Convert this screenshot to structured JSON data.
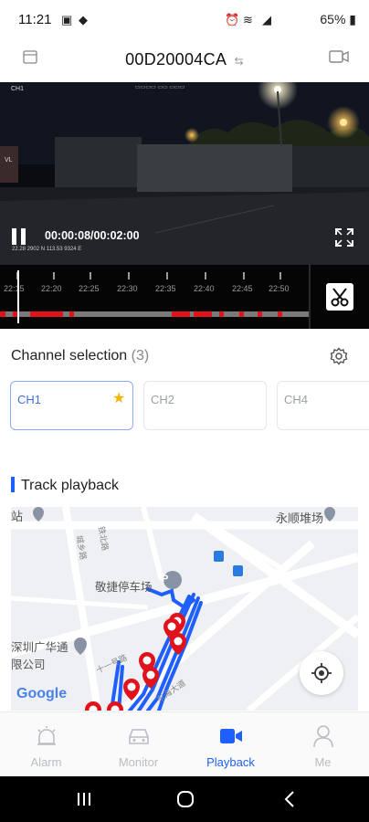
{
  "status_bar": {
    "time": "11:21",
    "battery": "65%"
  },
  "header": {
    "title": "00D20004CA"
  },
  "video": {
    "current_time": "00:00:08/00:02:00",
    "overlay_id": "CH1",
    "overlay_coords": "22.28 2902 N 113.53 9324 E",
    "overlay_left": "VL"
  },
  "timeline": {
    "ticks": [
      "22:15",
      "22:20",
      "22:25",
      "22:30",
      "22:35",
      "22:40",
      "22:45",
      "22:50"
    ]
  },
  "channels": {
    "title": "Channel selection",
    "count": "(3)",
    "items": [
      {
        "label": "CH1",
        "active": true
      },
      {
        "label": "CH2",
        "active": false
      },
      {
        "label": "CH4",
        "active": false
      }
    ]
  },
  "track": {
    "title": "Track playback",
    "map_labels": {
      "station": "站",
      "yard": "永顺堆场",
      "parking": "敬捷停车场",
      "company_1": "深圳广华通",
      "company_2": "限公司",
      "road_1": "铁北路",
      "road_2": "十一号路",
      "road_3": "东海大道",
      "road_4": "城乡路",
      "logo": "Google"
    }
  },
  "nav": {
    "items": [
      {
        "label": "Alarm",
        "active": false
      },
      {
        "label": "Monitor",
        "active": false
      },
      {
        "label": "Playback",
        "active": true
      },
      {
        "label": "Me",
        "active": false
      }
    ],
    "active_color": "#1f5eff"
  }
}
